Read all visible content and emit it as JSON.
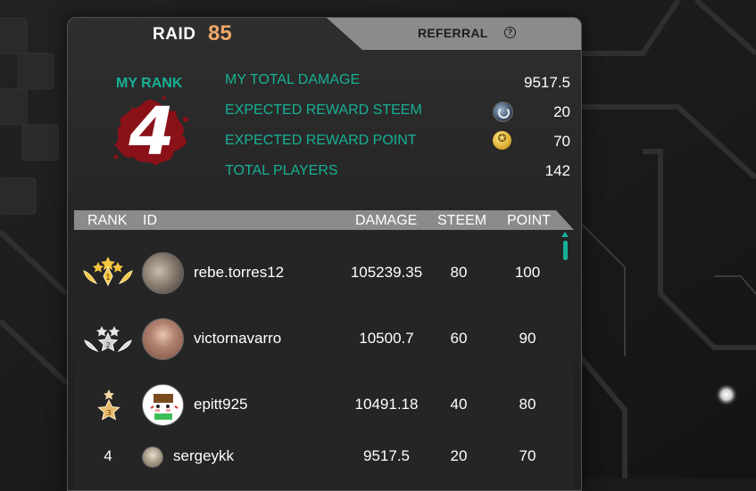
{
  "header": {
    "raid_label": "RAID",
    "raid_number": "85",
    "referral_label": "REFERRAL",
    "help_glyph": "?"
  },
  "my_rank": {
    "label": "MY RANK",
    "rank": "4",
    "stats": [
      {
        "label": "MY TOTAL DAMAGE",
        "value": "9517.5",
        "icon": ""
      },
      {
        "label": "EXPECTED REWARD STEEM",
        "value": "20",
        "icon": "steem-coin-icon"
      },
      {
        "label": "EXPECTED REWARD POINT",
        "value": "70",
        "icon": "point-coin-icon"
      },
      {
        "label": "TOTAL PLAYERS",
        "value": "142",
        "icon": ""
      }
    ]
  },
  "table": {
    "headers": {
      "rank": "RANK",
      "id": "ID",
      "damage": "DAMAGE",
      "steem": "STEEM",
      "point": "POINT"
    },
    "rows": [
      {
        "rank": "1",
        "medal": "gold",
        "id": "rebe.torres12",
        "damage": "105239.35",
        "steem": "80",
        "point": "100"
      },
      {
        "rank": "2",
        "medal": "silver",
        "id": "victornavarro",
        "damage": "10500.7",
        "steem": "60",
        "point": "90"
      },
      {
        "rank": "3",
        "medal": "bronze",
        "id": "epitt925",
        "damage": "10491.18",
        "steem": "40",
        "point": "80"
      },
      {
        "rank": "4",
        "medal": "",
        "id": "sergeykk",
        "damage": "9517.5",
        "steem": "20",
        "point": "70"
      }
    ]
  },
  "colors": {
    "accent_teal": "#17b095",
    "raid_orange": "#f0a868",
    "rank_blood": "#8a1118",
    "tab_gray": "#8b8b8b"
  }
}
